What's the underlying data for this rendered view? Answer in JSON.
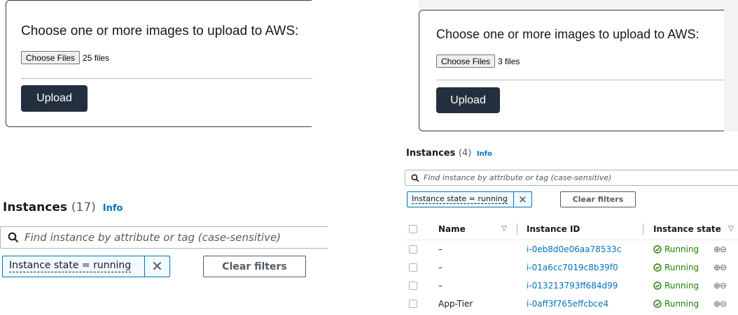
{
  "upload_left": {
    "title": "Choose one or more images to upload to AWS:",
    "choose_label": "Choose Files",
    "file_count": "25 files",
    "upload_label": "Upload"
  },
  "upload_right": {
    "title": "Choose one or more images to upload to AWS:",
    "choose_label": "Choose Files",
    "file_count": "3 files",
    "upload_label": "Upload"
  },
  "instances_left": {
    "title": "Instances",
    "count": "(17)",
    "info": "Info",
    "search_placeholder": "Find instance by attribute or tag (case-sensitive)",
    "filter_token": "Instance state = running",
    "clear_label": "Clear filters"
  },
  "instances_right": {
    "title": "Instances",
    "count": "(4)",
    "info": "Info",
    "search_placeholder": "Find instance by attribute or tag (case-sensitive)",
    "filter_token": "Instance state = running",
    "clear_label": "Clear filters",
    "columns": {
      "name": "Name",
      "instance_id": "Instance ID",
      "instance_state": "Instance state"
    },
    "rows": [
      {
        "name": "–",
        "id": "i-0eb8d0e06aa78533c",
        "state": "Running"
      },
      {
        "name": "–",
        "id": "i-01a6cc7019c8b39f0",
        "state": "Running"
      },
      {
        "name": "–",
        "id": "i-013213793ff684d99",
        "state": "Running"
      },
      {
        "name": "App-Tier",
        "id": "i-0aff3f765effcbce4",
        "state": "Running"
      }
    ]
  },
  "icons": {
    "search": "search-icon",
    "dismiss": "close-icon",
    "sort": "caret-down-icon",
    "status": "check-circle-icon",
    "zoom": "zoom-in-out-icon"
  },
  "colors": {
    "upload_button": "#232f3e",
    "link": "#0073bb",
    "running": "#1d8102",
    "token_bg": "#f1faff"
  }
}
